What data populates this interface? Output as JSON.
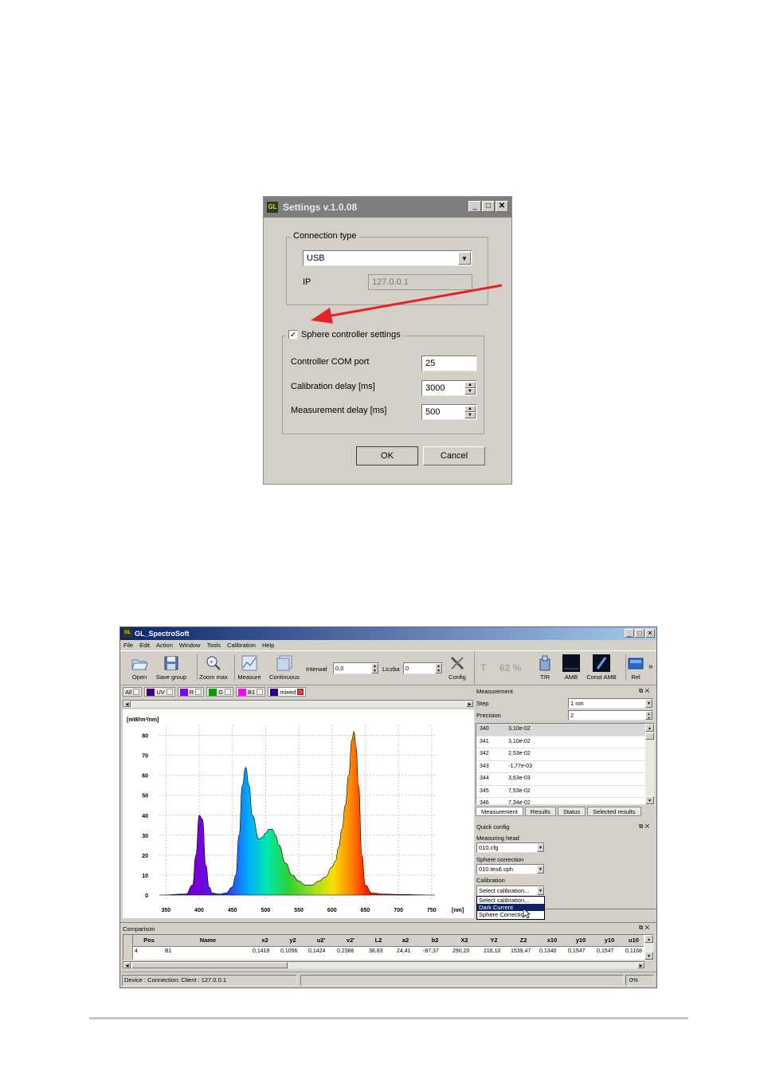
{
  "settings_dialog": {
    "title": "Settings v.1.0.08",
    "logo": "GL",
    "connection_group": "Connection type",
    "connection_value": "USB",
    "ip_label": "IP",
    "ip_value": "127.0.0.1",
    "sphere_checked": true,
    "sphere_group": "Sphere controller settings",
    "com_port_label": "Controller COM port",
    "com_port_value": "25",
    "calib_delay_label": "Calibration delay [ms]",
    "calib_delay_value": "3000",
    "meas_delay_label": "Measurement delay [ms]",
    "meas_delay_value": "500",
    "ok": "OK",
    "cancel": "Cancel",
    "arrow_color": "#e8202a"
  },
  "app": {
    "title": "GL_SpectroSoft",
    "menu": [
      "File",
      "Edit",
      "Action",
      "Window",
      "Tools",
      "Calibration",
      "Help"
    ],
    "toolbar": {
      "open": "Open",
      "save_group": "Save group",
      "zoom_max": "Zoom max",
      "measure": "Measure",
      "continuous": "Continuous",
      "interval_label": "Interwał",
      "interval_value": "0,0",
      "count_label": "Liczba",
      "count_value": "0",
      "config": "Config",
      "t_label": "T",
      "t_value": "62 %",
      "tr": "T/R",
      "amb": "AMB",
      "const_amb": "Const AMB",
      "rel": "Rel",
      "more": "»"
    },
    "series_tabs": [
      {
        "label": "All",
        "color": ""
      },
      {
        "label": "UV",
        "color": "#3a0080"
      },
      {
        "label": "R",
        "color": "#7a00ff"
      },
      {
        "label": "G",
        "color": "#00a000"
      },
      {
        "label": "B1",
        "color": "#ff00ff"
      },
      {
        "label": "mixed",
        "color": "#2a0080"
      }
    ],
    "chart_data": {
      "type": "area",
      "ylabel": "[mW/m²/nm]",
      "xlabel": "[nm]",
      "x_ticks": [
        350,
        400,
        450,
        500,
        550,
        600,
        650,
        700,
        750
      ],
      "y_ticks": [
        0,
        10,
        20,
        30,
        40,
        50,
        60,
        70,
        80
      ],
      "xlim": [
        340,
        755
      ],
      "ylim": [
        -2,
        85
      ],
      "grid": true,
      "x": [
        340,
        380,
        390,
        395,
        400,
        405,
        410,
        415,
        420,
        430,
        440,
        450,
        455,
        460,
        465,
        470,
        475,
        480,
        490,
        495,
        500,
        505,
        510,
        515,
        520,
        530,
        540,
        550,
        560,
        570,
        580,
        590,
        600,
        605,
        610,
        615,
        620,
        625,
        630,
        633,
        636,
        640,
        645,
        650,
        660,
        680,
        700,
        755
      ],
      "y": [
        0,
        0.5,
        5,
        20,
        40,
        38,
        15,
        4,
        1,
        0.5,
        1,
        4,
        10,
        30,
        55,
        64,
        55,
        40,
        28,
        29,
        31,
        33,
        33,
        30,
        25,
        16,
        10,
        7,
        5,
        5,
        7,
        9,
        14,
        17,
        24,
        33,
        45,
        60,
        78,
        82,
        75,
        55,
        20,
        5,
        1,
        0.5,
        0.3,
        0
      ]
    },
    "measurement_panel": {
      "title": "Measurement",
      "step_label": "Step",
      "step_value": "1 nm",
      "precision_label": "Precision",
      "precision_value": "2",
      "rows": [
        [
          "340",
          "3,10e-02"
        ],
        [
          "341",
          "3,10e-02"
        ],
        [
          "342",
          "2,53e-02"
        ],
        [
          "343",
          "-1,77e-03"
        ],
        [
          "344",
          "3,63e-03"
        ],
        [
          "345",
          "7,53e-02"
        ],
        [
          "346",
          "7,34e-02"
        ]
      ],
      "tabs": [
        "Measurement",
        "Results",
        "Status",
        "Selected results"
      ]
    },
    "quick_config": {
      "title": "Quick config",
      "head_label": "Measuring head",
      "head_value": "010.cfg",
      "sphere_label": "Sphere correction",
      "sphere_value": "010.tes6.sph",
      "calib_label": "Calibration",
      "calib_value": "Select calibration...",
      "dropdown_items": [
        "Select calibration...",
        "Dark Current",
        "Sphere Correction"
      ]
    },
    "comparison": {
      "title": "Comparison",
      "columns": [
        "Pos",
        "Name",
        "x2",
        "y2",
        "u2'",
        "v2'",
        "L2",
        "a2",
        "b2",
        "X2",
        "Y2",
        "Z2",
        "x10",
        "y10",
        "y10",
        "u10"
      ],
      "row": [
        "4",
        "B1",
        "0,1419",
        "0,1056",
        "0,1424",
        "0,2386",
        "38,83",
        "24,41",
        "-87,37",
        "290,20",
        "216,10",
        "1539,47",
        "0,1340",
        "0,1547",
        "0,1547",
        "0,1168"
      ]
    },
    "status": {
      "text": "Device : Connection: Client : 127.0.0.1",
      "percent": "0%"
    }
  }
}
